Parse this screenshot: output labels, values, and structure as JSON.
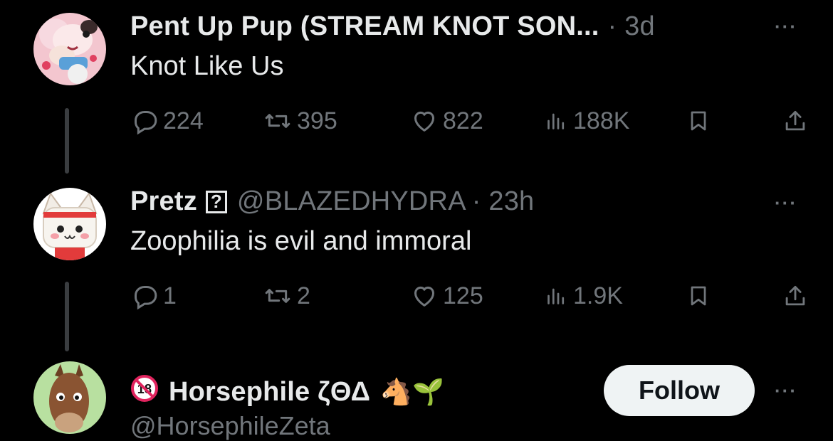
{
  "tweets": [
    {
      "author_name": "Pent Up Pup (STREAM KNOT SON...",
      "time": "· 3d",
      "more": "···",
      "text": "Knot Like Us",
      "replies": "224",
      "retweets": "395",
      "likes": "822",
      "views": "188K"
    },
    {
      "author_name": "Pretz",
      "verified_mark": "?",
      "handle": "@BLAZEDHYDRA",
      "time": "· 23h",
      "more": "···",
      "text": "Zoophilia is evil and immoral",
      "replies": "1",
      "retweets": "2",
      "likes": "125",
      "views": "1.9K"
    }
  ],
  "suggested": {
    "badge": "18",
    "name": "Horsephile ζΘΔ",
    "emoji": "🐴🌱",
    "handle": "@HorsephileZeta",
    "follow_label": "Follow",
    "more": "···"
  },
  "colors": {
    "background": "#000000",
    "text": "#e7e9ea",
    "muted": "#71767b",
    "thread_line": "#3a3d40",
    "follow_bg": "#eff3f4"
  },
  "icons": [
    "reply-icon",
    "retweet-icon",
    "like-icon",
    "views-icon",
    "bookmark-icon",
    "share-icon",
    "more-icon",
    "no-under-18-icon"
  ]
}
